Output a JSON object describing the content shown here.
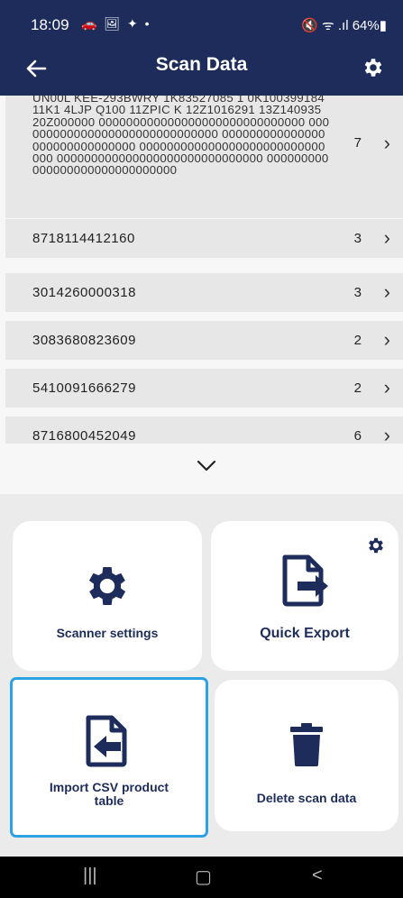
{
  "status_bar": {
    "time": "18:09",
    "notification_icons": "🚗 🖼 ✦ •",
    "right": "🔇 ᯤ .ıl 64%▮"
  },
  "app_bar": {
    "back_icon": "back-arrow-icon",
    "title": "Scan Data",
    "settings_icon": "gear-icon"
  },
  "scan_list": [
    {
      "code": "UN00L KEE-293BWRY 1K83527085 1 0K100399184 11K1 4LJP Q100 11ZPIC K 12Z1016291 13Z140935 20Z000000 000000000000000000000000000000 000000000000000000000000000000 000000000000000000000000000000 000000000000000000000000000000 000000000000000000000000000000 000000000000000000000000000000",
      "count": "7"
    },
    {
      "code": "8718114412160",
      "count": "3"
    },
    {
      "code": "3014260000318",
      "count": "3"
    },
    {
      "code": "3083680823609",
      "count": "2"
    },
    {
      "code": "5410091666279",
      "count": "2"
    },
    {
      "code": "8716800452049",
      "count": "6"
    }
  ],
  "actions": {
    "scanner_settings": "Scanner settings",
    "quick_export": "Quick Export",
    "import_csv": "Import CSV product table",
    "delete_scan_data": "Delete scan data"
  },
  "colors": {
    "brand": "#1e2c5c",
    "selection": "#2aa3e0"
  },
  "nav_bar": {
    "recent": "|||",
    "home": "▢",
    "back": "<"
  }
}
